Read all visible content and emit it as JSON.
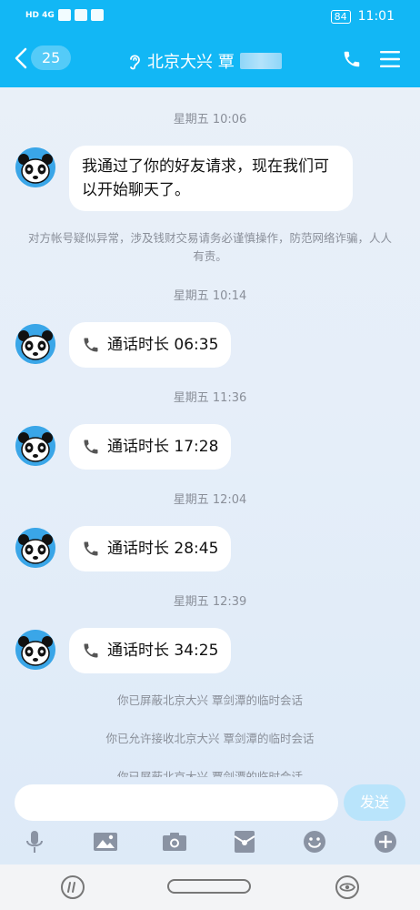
{
  "statusbar": {
    "network": "HD 4G",
    "battery": "84",
    "time": "11:01"
  },
  "header": {
    "back_count": "25",
    "contact_name": "北京大兴 覃"
  },
  "messages": [
    {
      "type": "time",
      "text": "星期五 10:06"
    },
    {
      "type": "text",
      "text": "我通过了你的好友请求，现在我们可以开始聊天了。"
    },
    {
      "type": "system",
      "text": "对方帐号疑似异常，涉及钱财交易请务必谨慎操作，防范网络诈骗，人人有责。"
    },
    {
      "type": "time",
      "text": "星期五 10:14"
    },
    {
      "type": "call",
      "text": "通话时长 06:35"
    },
    {
      "type": "time",
      "text": "星期五 11:36"
    },
    {
      "type": "call",
      "text": "通话时长 17:28"
    },
    {
      "type": "time",
      "text": "星期五 12:04"
    },
    {
      "type": "call",
      "text": "通话时长 28:45"
    },
    {
      "type": "time",
      "text": "星期五 12:39"
    },
    {
      "type": "call",
      "text": "通话时长 34:25"
    },
    {
      "type": "system",
      "text": "你已屏蔽北京大兴 覃剑潭的临时会话"
    },
    {
      "type": "system",
      "text": "你已允许接收北京大兴 覃剑潭的临时会话"
    },
    {
      "type": "system",
      "text": "你已屏蔽北京大兴 覃剑潭的临时会话"
    }
  ],
  "input": {
    "value": "",
    "send_label": "发送"
  },
  "toolbar": {
    "icons": [
      "microphone-icon",
      "image-icon",
      "camera-icon",
      "red-packet-icon",
      "emoji-icon",
      "plus-icon"
    ]
  },
  "colors": {
    "accent": "#12b7f5",
    "send_disabled": "#b9e4fb",
    "call_icon": "#555555"
  }
}
